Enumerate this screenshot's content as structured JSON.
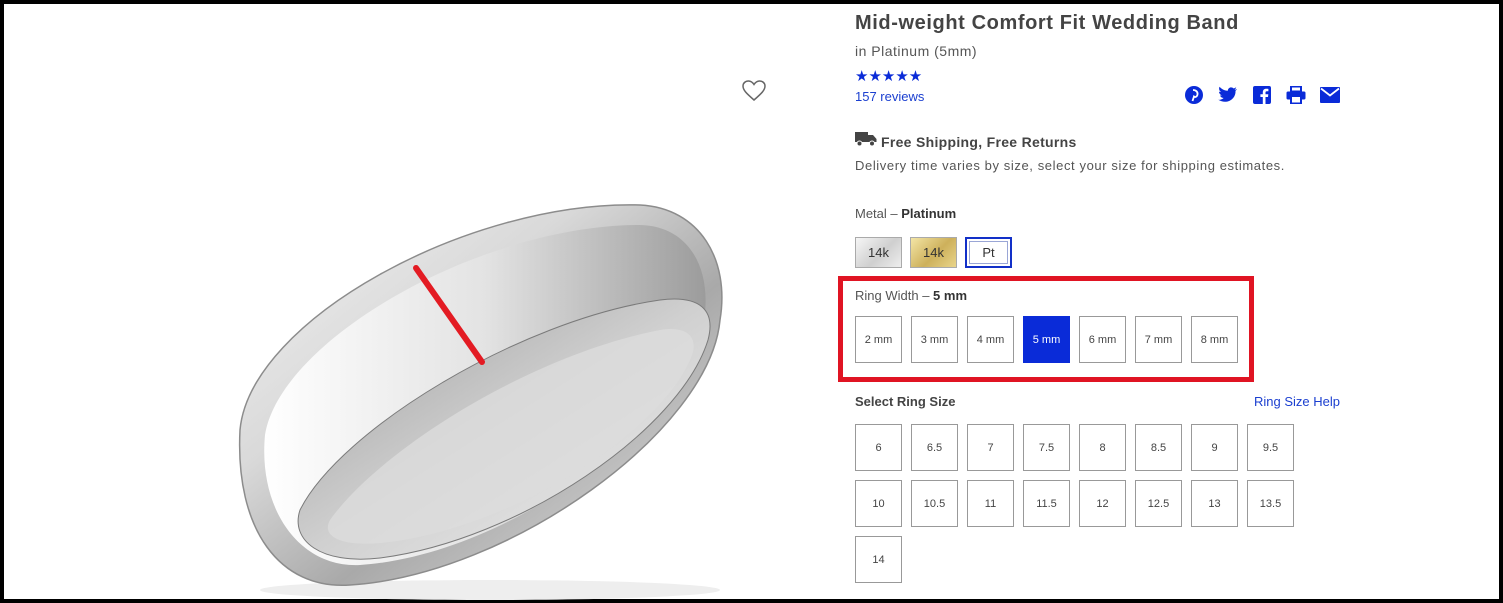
{
  "product": {
    "title": "Mid-weight Comfort Fit Wedding Band",
    "subtitle": "in Platinum (5mm)",
    "stars": "★★★★★",
    "rating": 5,
    "reviews_label": "157 reviews"
  },
  "share_icons": [
    "pinterest-icon",
    "twitter-icon",
    "facebook-icon",
    "print-icon",
    "email-icon"
  ],
  "shipping": {
    "title": "Free Shipping, Free Returns",
    "note": "Delivery time varies by size, select your size for shipping estimates."
  },
  "metal": {
    "label": "Metal –",
    "selected": "Platinum",
    "options": [
      "14k",
      "14k",
      "Pt"
    ]
  },
  "ring_width": {
    "label": "Ring Width –",
    "selected": "5 mm",
    "options": [
      "2 mm",
      "3 mm",
      "4 mm",
      "5 mm",
      "6 mm",
      "7 mm",
      "8 mm"
    ]
  },
  "ring_size": {
    "label": "Select Ring Size",
    "help_link": "Ring Size Help",
    "options": [
      "6",
      "6.5",
      "7",
      "7.5",
      "8",
      "8.5",
      "9",
      "9.5",
      "10",
      "10.5",
      "11",
      "11.5",
      "12",
      "12.5",
      "13",
      "13.5",
      "14"
    ]
  },
  "colors": {
    "accent": "#0a2bd8",
    "highlight": "#e01423"
  }
}
